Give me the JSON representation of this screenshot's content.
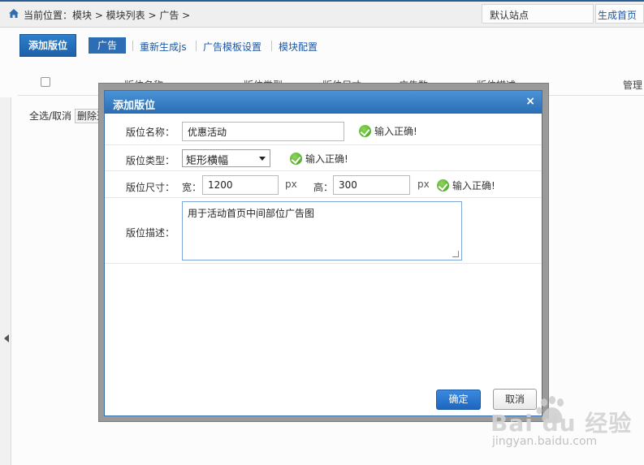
{
  "topbar": {
    "breadcrumb": "当前位置：模块 > 模块列表 > 广告 >",
    "site_select": "默认站点",
    "generate_home_button": "生成首页"
  },
  "toolbar": {
    "add_slot_button": "添加版位",
    "nav": [
      "广告",
      "重新生成js",
      "广告模板设置",
      "模块配置"
    ]
  },
  "table": {
    "columns": [
      "版位名称",
      "版位类型",
      "版位尺寸",
      "广告数",
      "版位描述",
      "管理"
    ],
    "footer_select_all": "全选/取消",
    "footer_delete": "删除选"
  },
  "dialog": {
    "title": "添加版位",
    "close": "×",
    "fields": {
      "name": {
        "label": "版位名称：",
        "value": "优惠活动",
        "status": "输入正确!"
      },
      "type": {
        "label": "版位类型：",
        "value": "矩形横幅",
        "status": "输入正确!"
      },
      "size": {
        "label": "版位尺寸：",
        "width_label": "宽：",
        "width_value": "1200",
        "width_unit": "px",
        "height_label": "高：",
        "height_value": "300",
        "height_unit": "px",
        "status": "输入正确!"
      },
      "description": {
        "label": "版位描述：",
        "value": "用于活动首页中间部位广告图"
      }
    },
    "confirm_button": "确定",
    "cancel_button": "取消"
  },
  "watermark": {
    "brand": "Bai du 经验",
    "url": "jingyan.baidu.com"
  },
  "colors": {
    "accent": "#2a6db3",
    "success": "#3b9e18"
  }
}
